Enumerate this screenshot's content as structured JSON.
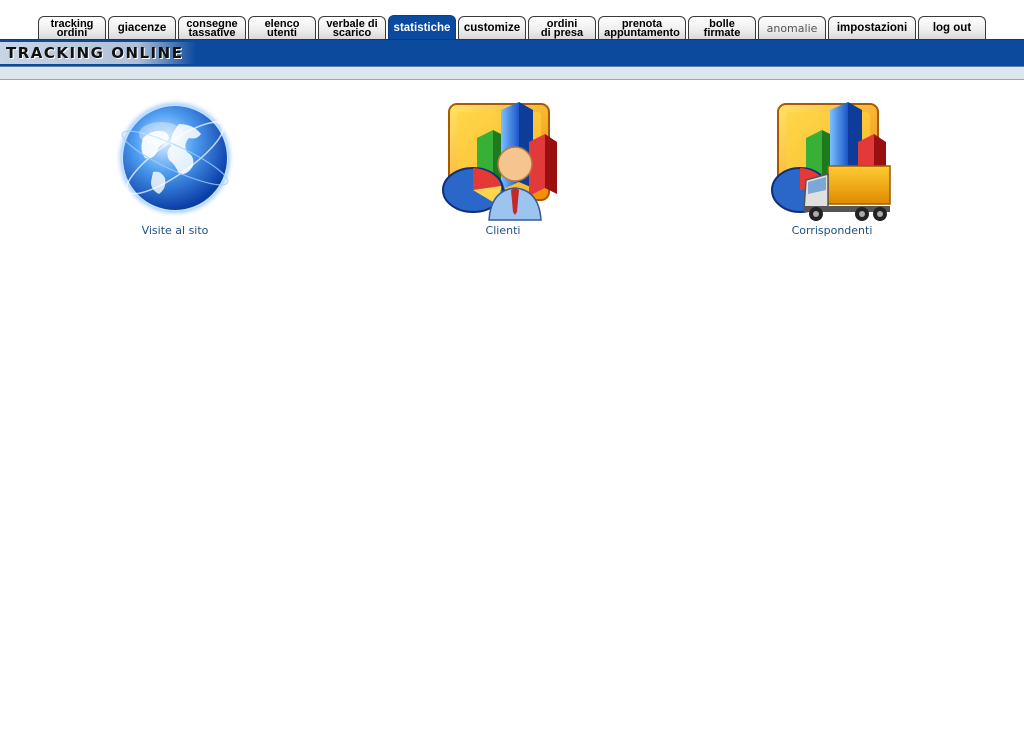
{
  "tabs": [
    {
      "label": "tracking\nordini",
      "state": "normal"
    },
    {
      "label": "giacenze",
      "state": "normal"
    },
    {
      "label": "consegne\ntassative",
      "state": "normal"
    },
    {
      "label": "elenco\nutenti",
      "state": "normal"
    },
    {
      "label": "verbale di\nscarico",
      "state": "normal"
    },
    {
      "label": "statistiche",
      "state": "active"
    },
    {
      "label": "customize",
      "state": "normal"
    },
    {
      "label": "ordini\ndi presa",
      "state": "normal"
    },
    {
      "label": "prenota\nappuntamento",
      "state": "normal"
    },
    {
      "label": "bolle\nfirmate",
      "state": "normal"
    },
    {
      "label": "anomalie",
      "state": "disabled"
    },
    {
      "label": "impostazioni",
      "state": "normal"
    },
    {
      "label": "log out",
      "state": "normal"
    }
  ],
  "header": {
    "logo_text": "TRACKING ONLINE"
  },
  "colors": {
    "band": "#0c4a9e",
    "active_tab": "#0a4aa0",
    "link_text": "#1f4f86"
  },
  "items": [
    {
      "label": "Visite al sito",
      "icon": "globe-icon"
    },
    {
      "label": "Clienti",
      "icon": "chart-user-icon"
    },
    {
      "label": "Corrispondenti",
      "icon": "chart-truck-icon"
    }
  ]
}
